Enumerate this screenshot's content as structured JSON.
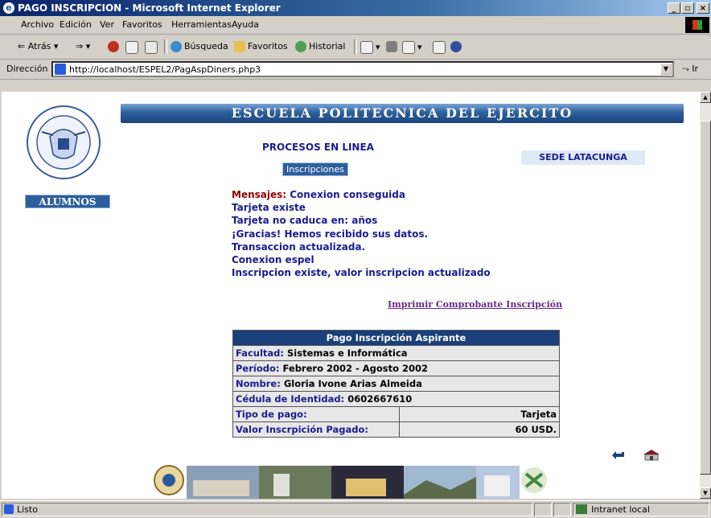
{
  "window": {
    "title": "PAGO INSCRIPCION - Microsoft Internet Explorer"
  },
  "menu": [
    "Archivo",
    "Edición",
    "Ver",
    "Favoritos",
    "Herramientas",
    "Ayuda"
  ],
  "toolbar": {
    "back": "Atrás",
    "search": "Búsqueda",
    "favorites": "Favoritos",
    "history": "Historial"
  },
  "address": {
    "label": "Dirección",
    "url": "http://localhost/ESPEL2/PagAspDiners.php3",
    "go": "Ir"
  },
  "page": {
    "banner": "ESCUELA POLITECNICA DEL EJERCITO",
    "alumnos": "ALUMNOS",
    "procesos": "PROCESOS EN LINEA",
    "inscripciones": "Inscripciones",
    "sede": "SEDE LATACUNGA",
    "mensajes_label": "Mensajes:",
    "messages": [
      "Conexion conseguida",
      "Tarjeta existe",
      "Tarjeta no caduca en: años",
      "¡Gracias! Hemos recibido sus datos.",
      "Transaccion actualizada.",
      "Conexion espel",
      "Inscripcion existe, valor inscripcion actualizado"
    ],
    "print_link": "Imprimir Comprobante Inscripción"
  },
  "table": {
    "header": "Pago Inscripción Aspirante",
    "facultad_label": "Facultad:",
    "facultad": "Sistemas e Informática",
    "periodo_label": "Período:",
    "periodo": "Febrero 2002 - Agosto 2002",
    "nombre_label": "Nombre:",
    "nombre": "Gloria Ivone Arias Almeida",
    "cedula_label": "Cédula de Identidad:",
    "cedula": "0602667610",
    "tipo_label": "Tipo de pago:",
    "tipo": "Tarjeta",
    "valor_label": "Valor Inscrpición Pagado:",
    "valor": "60 USD."
  },
  "status": {
    "left": "Listo",
    "zone": "Intranet local"
  },
  "colors": {
    "titlebar": "#0a246a",
    "banner": "#2e5f9c",
    "text_blue": "#1b1b8f",
    "mensajes": "#8b0000",
    "table_header": "#1a3f7a"
  }
}
